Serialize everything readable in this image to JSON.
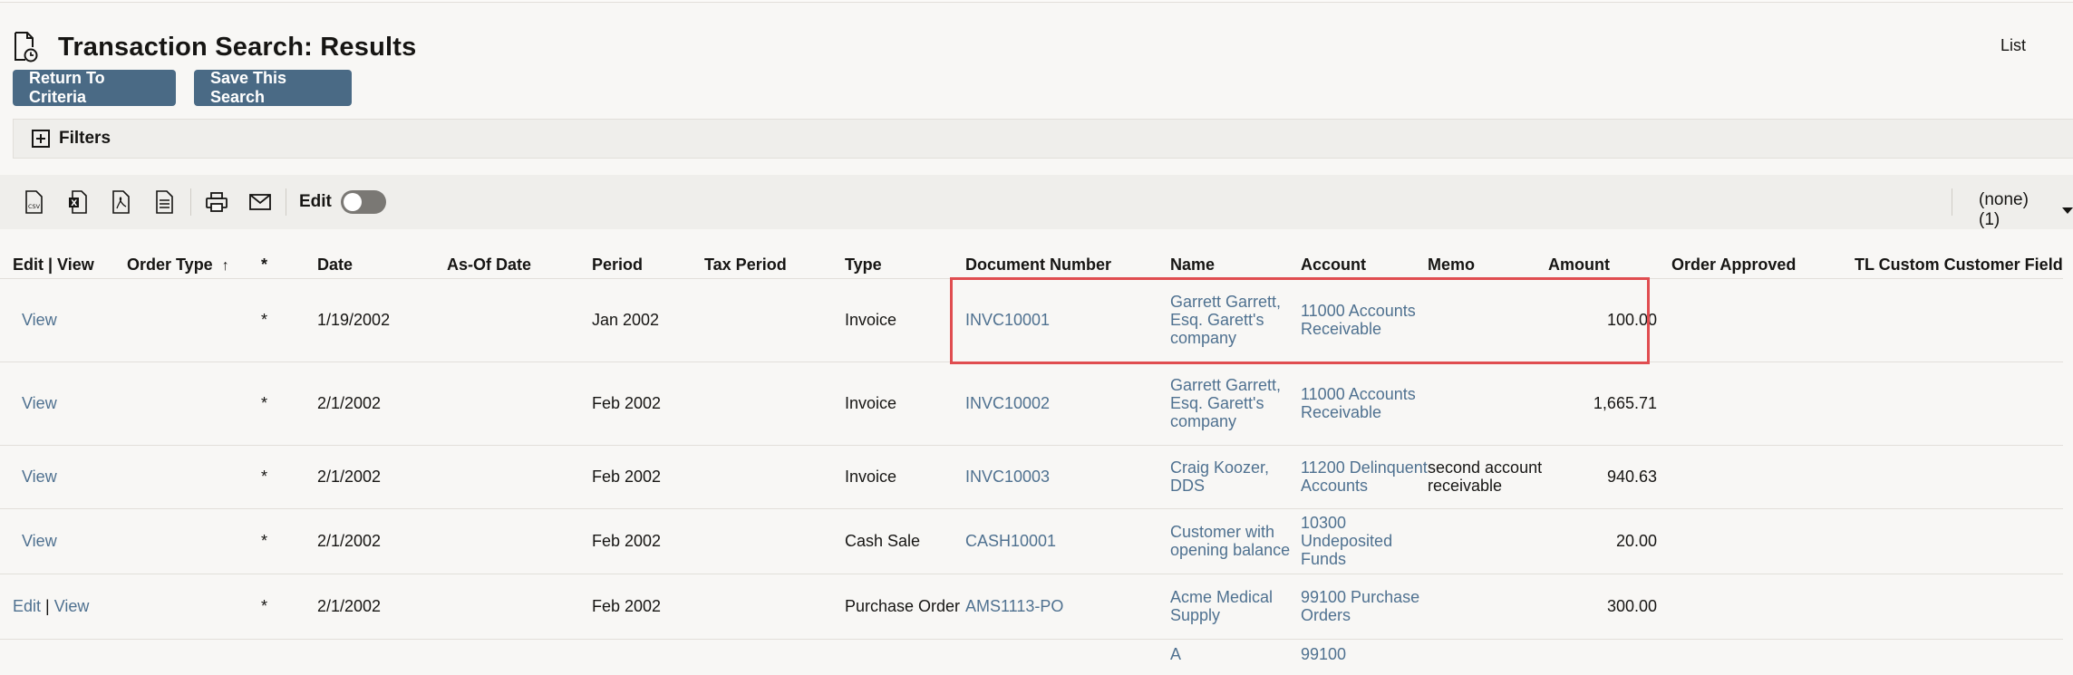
{
  "page": {
    "title": "Transaction Search: Results",
    "list_link": "List"
  },
  "buttons": {
    "return_label": "Return To Criteria",
    "save_label": "Save This Search"
  },
  "filters": {
    "label": "Filters"
  },
  "toolbar": {
    "icons": [
      "csv-export-icon",
      "excel-export-icon",
      "pdf-export-icon",
      "document-icon",
      "print-icon",
      "email-icon"
    ],
    "edit_label": "Edit",
    "edit_toggle_on": false,
    "view_select": "(none)(1)"
  },
  "table": {
    "headers": [
      "Edit | View",
      "Order Type",
      "*",
      "Date",
      "As-Of Date",
      "Period",
      "Tax Period",
      "Type",
      "Document Number",
      "Name",
      "Account",
      "Memo",
      "Amount",
      "Order Approved",
      "TL Custom Customer Field"
    ],
    "rows": [
      {
        "edit": "",
        "view": "View",
        "order_type": "",
        "star": "*",
        "date": "1/19/2002",
        "asof": "",
        "period": "Jan 2002",
        "tax_period": "",
        "type": "Invoice",
        "doc": "INVC10001",
        "name": "Garrett Garrett, Esq. Garett's company",
        "account": "11000 Accounts Receivable",
        "memo": "",
        "amount": "100.00",
        "approved": "",
        "tl": ""
      },
      {
        "edit": "",
        "view": "View",
        "order_type": "",
        "star": "*",
        "date": "2/1/2002",
        "asof": "",
        "period": "Feb 2002",
        "tax_period": "",
        "type": "Invoice",
        "doc": "INVC10002",
        "name": "Garrett Garrett, Esq. Garett's company",
        "account": "11000 Accounts Receivable",
        "memo": "",
        "amount": "1,665.71",
        "approved": "",
        "tl": ""
      },
      {
        "edit": "",
        "view": "View",
        "order_type": "",
        "star": "*",
        "date": "2/1/2002",
        "asof": "",
        "period": "Feb 2002",
        "tax_period": "",
        "type": "Invoice",
        "doc": "INVC10003",
        "name": "Craig Koozer, DDS",
        "account": "11200 Delinquent Accounts",
        "memo": "second account receivable",
        "amount": "940.63",
        "approved": "",
        "tl": ""
      },
      {
        "edit": "",
        "view": "View",
        "order_type": "",
        "star": "*",
        "date": "2/1/2002",
        "asof": "",
        "period": "Feb 2002",
        "tax_period": "",
        "type": "Cash Sale",
        "doc": "CASH10001",
        "name": "Customer with opening balance",
        "account": "10300 Undeposited Funds",
        "memo": "",
        "amount": "20.00",
        "approved": "",
        "tl": ""
      },
      {
        "edit": "Edit",
        "view": "View",
        "order_type": "",
        "star": "*",
        "date": "2/1/2002",
        "asof": "",
        "period": "Feb 2002",
        "tax_period": "",
        "type": "Purchase Order",
        "doc": "AMS1113-PO",
        "name": "Acme Medical Supply",
        "account": "99100 Purchase Orders",
        "memo": "",
        "amount": "300.00",
        "approved": "",
        "tl": ""
      },
      {
        "edit": "",
        "view": "",
        "order_type": "",
        "star": "",
        "date": "",
        "asof": "",
        "period": "",
        "tax_period": "",
        "type": "",
        "doc": "",
        "name": "A",
        "account": "99100",
        "memo": "",
        "amount": "",
        "approved": "",
        "tl": ""
      }
    ]
  },
  "colors": {
    "button_bg": "#4a6a85",
    "link": "#4f7190",
    "highlight": "#e04d50"
  }
}
